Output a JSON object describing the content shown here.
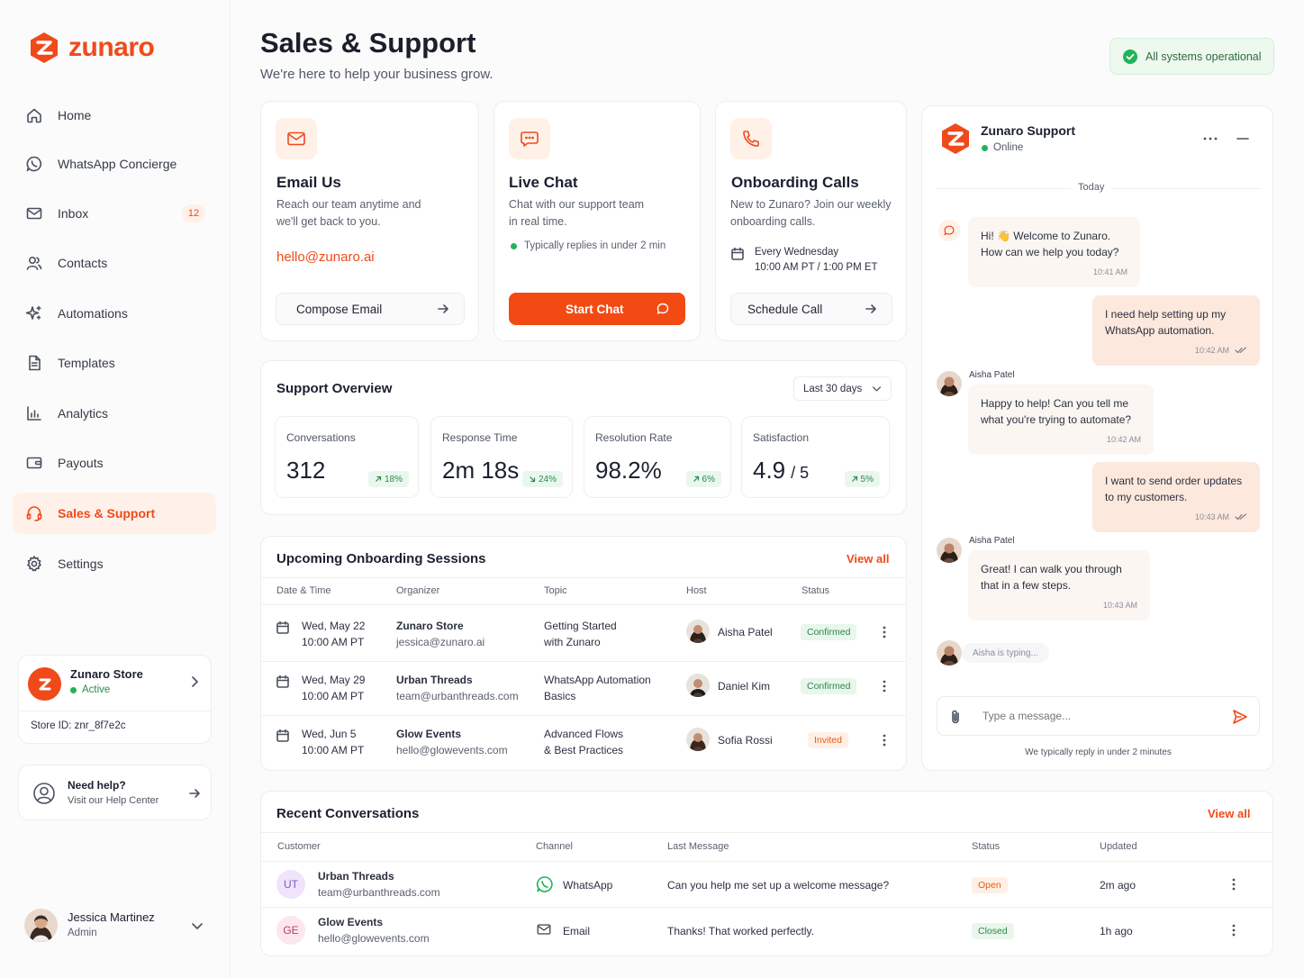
{
  "brand": {
    "name": "zunaro",
    "accent": "#f04a1a"
  },
  "nav": [
    {
      "label": "Home",
      "icon": "home-icon"
    },
    {
      "label": "WhatsApp Concierge",
      "icon": "whatsapp-icon"
    },
    {
      "label": "Inbox",
      "icon": "mail-icon",
      "badge": "12"
    },
    {
      "label": "Contacts",
      "icon": "users-icon"
    },
    {
      "label": "Automations",
      "icon": "sparkle-icon"
    },
    {
      "label": "Templates",
      "icon": "document-icon"
    },
    {
      "label": "Analytics",
      "icon": "chart-icon"
    },
    {
      "label": "Payouts",
      "icon": "wallet-icon"
    },
    {
      "label": "Sales & Support",
      "icon": "headset-icon",
      "active": true
    },
    {
      "label": "Settings",
      "icon": "gear-icon"
    }
  ],
  "store": {
    "name": "Zunaro Store",
    "status": "Active",
    "store_id": "Store ID: znr_8f7e2c"
  },
  "help": {
    "title": "Need help?",
    "subtitle": "Visit our Help Center"
  },
  "user": {
    "name": "Jessica Martinez",
    "role": "Admin"
  },
  "header": {
    "title": "Sales & Support",
    "subtitle": "We're here to help your business grow.",
    "status": "All systems operational"
  },
  "email_card": {
    "title": "Email Us",
    "desc_line1": "Reach our team anytime and",
    "desc_line2": "we'll get back to you.",
    "email": "hello@zunaro.ai",
    "button": "Compose Email"
  },
  "chat_card": {
    "title": "Live Chat",
    "desc_line1": "Chat with our support team",
    "desc_line2": "in real time.",
    "reply_note": "Typically replies in under 2 min",
    "button": "Start Chat"
  },
  "calls_card": {
    "title": "Onboarding Calls",
    "desc_line1": "New to Zunaro? Join our weekly",
    "desc_line2": "onboarding calls.",
    "schedule_line1": "Every Wednesday",
    "schedule_line2": "10:00 AM PT / 1:00 PM ET",
    "button": "Schedule Call"
  },
  "overview": {
    "title": "Support Overview",
    "range": "Last 30 days",
    "metrics": [
      {
        "label": "Conversations",
        "value": "312",
        "unit": "",
        "change": "18%",
        "dir": "up"
      },
      {
        "label": "Response Time",
        "value": "2m 18s",
        "unit": "",
        "change": "24%",
        "dir": "down"
      },
      {
        "label": "Resolution Rate",
        "value": "98.2%",
        "unit": "",
        "change": "6%",
        "dir": "up"
      },
      {
        "label": "Satisfaction",
        "value": "4.9",
        "unit": "/ 5",
        "change": "5%",
        "dir": "up"
      }
    ]
  },
  "sessions": {
    "title": "Upcoming Onboarding Sessions",
    "view_all": "View all",
    "columns": [
      "Date & Time",
      "Organizer",
      "Topic",
      "Host",
      "Status"
    ],
    "rows": [
      {
        "date": "Wed, May 22",
        "time": "10:00 AM PT",
        "org": "Zunaro Store",
        "org_email": "jessica@zunaro.ai",
        "topic1": "Getting Started",
        "topic2": "with Zunaro",
        "host": "Aisha Patel",
        "status": "Confirmed",
        "status_kind": "green"
      },
      {
        "date": "Wed, May 29",
        "time": "10:00 AM PT",
        "org": "Urban Threads",
        "org_email": "team@urbanthreads.com",
        "topic1": "WhatsApp Automation",
        "topic2": "Basics",
        "host": "Daniel Kim",
        "status": "Confirmed",
        "status_kind": "green"
      },
      {
        "date": "Wed, Jun 5",
        "time": "10:00 AM PT",
        "org": "Glow Events",
        "org_email": "hello@glowevents.com",
        "topic1": "Advanced Flows",
        "topic2": "& Best Practices",
        "host": "Sofia Rossi",
        "status": "Invited",
        "status_kind": "orange"
      }
    ]
  },
  "conversations": {
    "title": "Recent Conversations",
    "view_all": "View all",
    "columns": [
      "Customer",
      "Channel",
      "Last Message",
      "Status",
      "Updated"
    ],
    "rows": [
      {
        "initials": "UT",
        "name": "Urban Threads",
        "email": "team@urbanthreads.com",
        "channel": "WhatsApp",
        "message": "Can you help me set up a welcome message?",
        "status": "Open",
        "status_kind": "orange",
        "updated": "2m ago"
      },
      {
        "initials": "GE",
        "name": "Glow Events",
        "email": "hello@glowevents.com",
        "channel": "Email",
        "message": "Thanks! That worked perfectly.",
        "status": "Closed",
        "status_kind": "green",
        "updated": "1h ago"
      }
    ]
  },
  "chat": {
    "title": "Zunaro Support",
    "status": "Online",
    "day": "Today",
    "messages": [
      {
        "from": "bot",
        "line1": "Hi! 👋 Welcome to Zunaro.",
        "line2": "How can we help you today?",
        "time": "10:41 AM"
      },
      {
        "from": "me",
        "line1": "I need help setting up my",
        "line2": "WhatsApp automation.",
        "time": "10:42 AM"
      },
      {
        "from": "agent",
        "sender": "Aisha Patel",
        "line1": "Happy to help! Can you tell me",
        "line2": "what you're trying to automate?",
        "time": "10:42 AM"
      },
      {
        "from": "me",
        "line1": "I want to send order updates",
        "line2": "to my customers.",
        "time": "10:43 AM"
      },
      {
        "from": "agent",
        "sender": "Aisha Patel",
        "line1": "Great! I can walk you through",
        "line2": "that in a few steps.",
        "time": "10:43 AM"
      }
    ],
    "typing": "Aisha is typing...",
    "placeholder": "Type a message...",
    "footer": "We typically reply in under 2 minutes"
  }
}
